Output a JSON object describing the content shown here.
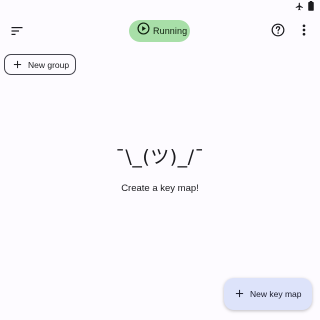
{
  "status_bar": {
    "icons": [
      "airplane-icon",
      "battery-icon"
    ]
  },
  "toolbar": {
    "menu_icon": "sort-menu-icon",
    "running_label": "Running",
    "running_icon": "play-circle-icon",
    "help_icon": "help-circle-icon",
    "more_icon": "more-vert-icon"
  },
  "new_group": {
    "label": "New group",
    "icon": "plus-icon"
  },
  "empty_state": {
    "face": "¯\\_(ツ)_/¯",
    "message": "Create a key map!"
  },
  "fab": {
    "label": "New key map",
    "icon": "plus-icon"
  },
  "colors": {
    "background": "#fdfbff",
    "running_chip": "#a8dfa8",
    "fab": "#dde3fa"
  }
}
